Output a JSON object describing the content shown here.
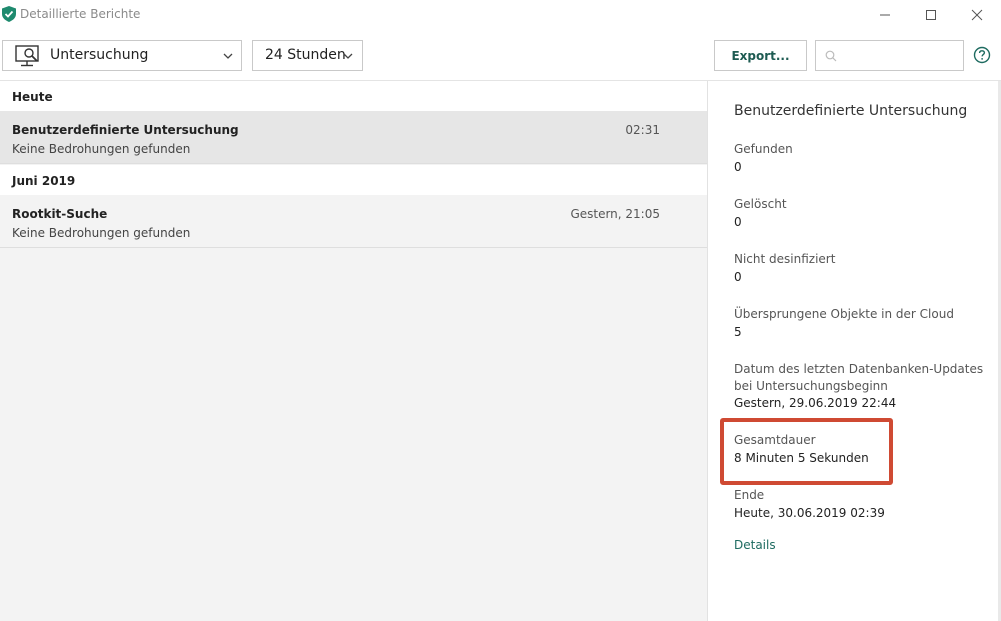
{
  "window": {
    "title": "Detaillierte Berichte",
    "icon": "shield-icon",
    "accent_color": "#1e6b60",
    "highlight_color": "#cf4a33"
  },
  "toolbar": {
    "scan_type": {
      "selected": "Untersuchung",
      "icon": "monitor-scan-icon"
    },
    "time_range": {
      "selected": "24 Stunden"
    },
    "export_label": "Export...",
    "search": {
      "value": "",
      "placeholder": ""
    },
    "help_icon": "help-circle-icon"
  },
  "report_list": {
    "groups": [
      {
        "header": "Heute",
        "items": [
          {
            "title": "Benutzerdefinierte Untersuchung",
            "subtitle": "Keine Bedrohungen gefunden",
            "time": "02:31",
            "selected": true
          }
        ]
      },
      {
        "header": "Juni 2019",
        "items": [
          {
            "title": "Rootkit-Suche",
            "subtitle": "Keine Bedrohungen gefunden",
            "time": "Gestern, 21:05",
            "selected": false
          }
        ]
      }
    ]
  },
  "details": {
    "title": "Benutzerdefinierte Untersuchung",
    "fields": [
      {
        "label": "Gefunden",
        "value": "0"
      },
      {
        "label": "Gelöscht",
        "value": "0"
      },
      {
        "label": "Nicht desinfiziert",
        "value": "0"
      },
      {
        "label": "Übersprungene Objekte in der Cloud",
        "value": "5"
      },
      {
        "label": "Datum des letzten Datenbanken-Updates bei Untersuchungsbeginn",
        "value": "Gestern, 29.06.2019 22:44"
      },
      {
        "label": "Gesamtdauer",
        "value": "8 Minuten 5 Sekunden"
      },
      {
        "label": "Ende",
        "value": "Heute, 30.06.2019 02:39"
      }
    ],
    "link_label": "Details"
  }
}
